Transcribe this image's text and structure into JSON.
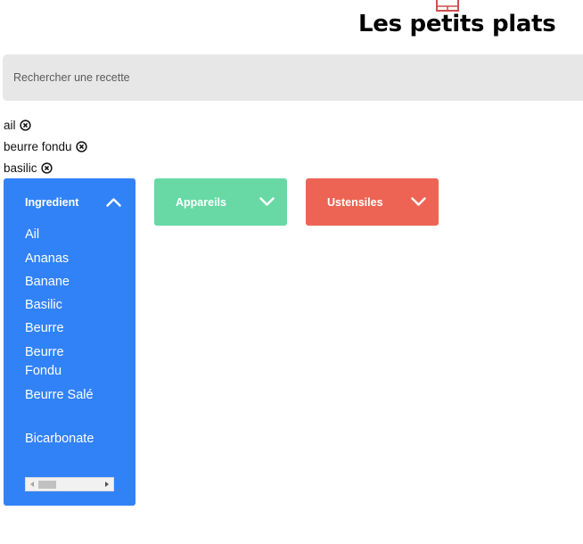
{
  "header": {
    "title": "Les petits plats",
    "logo_icon": "chef-hat-logo-icon",
    "accent_color": "#d04f4f"
  },
  "search": {
    "placeholder": "Rechercher une recette",
    "value": ""
  },
  "tags": [
    {
      "label": "ail",
      "close_icon": "circle-x-icon"
    },
    {
      "label": "beurre fondu",
      "close_icon": "circle-x-icon"
    },
    {
      "label": "basilic",
      "close_icon": "circle-x-icon"
    }
  ],
  "dropdowns": {
    "ingredients": {
      "label": "Ingredient",
      "expanded": true,
      "color": "#3282f7",
      "chevron_icon": "chevron-up-icon",
      "items": [
        "Ail",
        "Ananas",
        "Banane",
        "Basilic",
        "Beurre",
        "Beurre Fondu",
        "Beurre Salé",
        "Bicarbonate"
      ]
    },
    "appareils": {
      "label": "Appareils",
      "expanded": false,
      "color": "#68d9a4",
      "chevron_icon": "chevron-down-icon"
    },
    "ustensiles": {
      "label": "Ustensiles",
      "expanded": false,
      "color": "#ed6454",
      "chevron_icon": "chevron-down-icon"
    }
  }
}
